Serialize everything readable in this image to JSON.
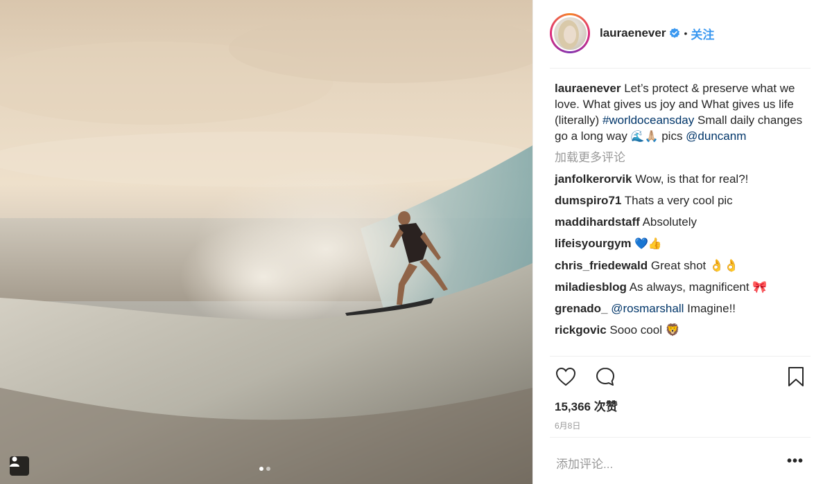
{
  "post": {
    "username": "laurae­never",
    "follow_label": "关注",
    "caption_text_1": "Let’s protect & preserve what we love. What gives us joy and What gives us life (literally) ",
    "caption_hashtag": "#worldoceansday",
    "caption_text_2": " Small daily changes go a long way ",
    "caption_emojis": "🌊🙏🏼",
    "caption_text_3": " pics ",
    "caption_mention": "@duncanm",
    "load_more_label": "加载更多评论",
    "likes_label": "15,366 次赞",
    "date_label": "6月8日",
    "add_comment_placeholder": "添加评论...",
    "more_label": "•••"
  },
  "comments": [
    {
      "user": "janfolkerorvik",
      "text": " Wow, is that for real?!"
    },
    {
      "user": "dumspiro71",
      "text": " Thats a very cool pic"
    },
    {
      "user": "maddihardstaff",
      "text": " Absolutely"
    },
    {
      "user": "lifeisyourgym",
      "text": " 💙👍"
    },
    {
      "user": "chris_friedewald",
      "text": " Great shot 👌👌"
    },
    {
      "user": "miladiesblog",
      "text": " As always, magnificent 🎀"
    },
    {
      "user": "grenado_",
      "mention": " @rosmarshall",
      "text": " Imagine!!"
    },
    {
      "user": "rickgovic",
      "text": " Sooo cool 🦁"
    }
  ],
  "icons": {
    "heart": "heart-icon",
    "comment": "comment-icon",
    "bookmark": "bookmark-icon",
    "verified": "verified-badge-icon",
    "user_tag": "user-tag-icon"
  },
  "colors": {
    "link": "#003569",
    "follow": "#3897f0",
    "muted": "#999999",
    "text": "#262626"
  },
  "carousel": {
    "count": 2,
    "active": 1
  }
}
